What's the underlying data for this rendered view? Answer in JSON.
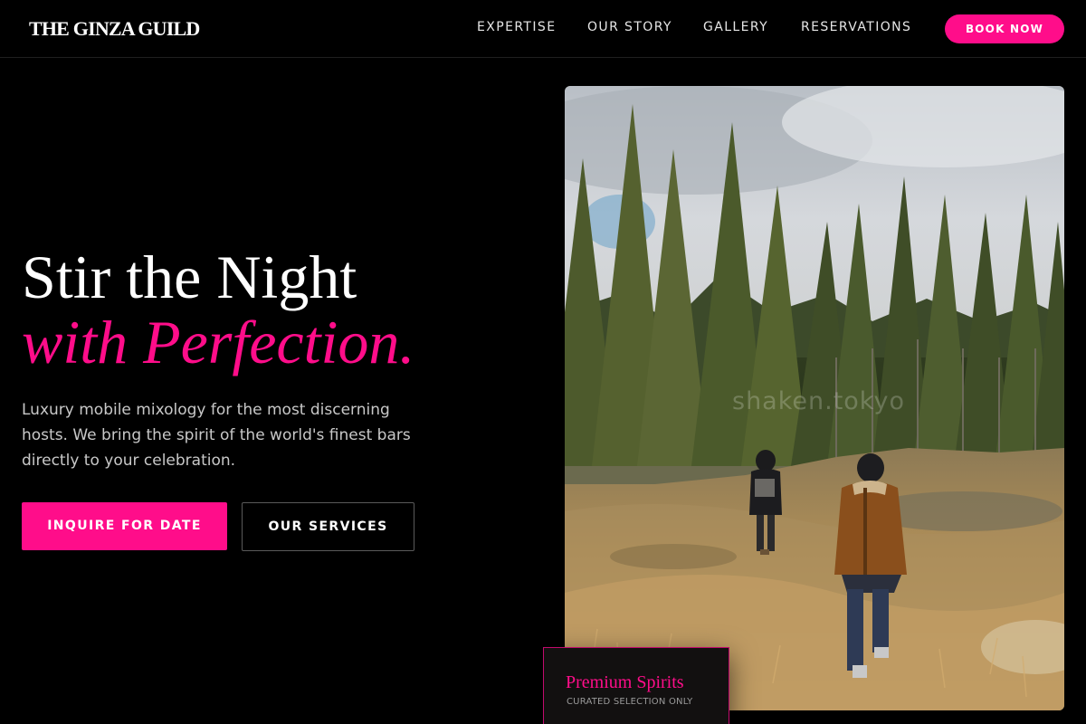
{
  "brand": {
    "name": "THE GINZA GUILD",
    "accent_color": "#ff0d8a"
  },
  "nav": {
    "items": [
      {
        "label": "EXPERTISE"
      },
      {
        "label": "OUR STORY"
      },
      {
        "label": "GALLERY"
      },
      {
        "label": "RESERVATIONS"
      }
    ],
    "cta_label": "BOOK NOW"
  },
  "hero": {
    "title_line1": "Stir the Night",
    "title_line2": "with Perfection.",
    "description": "Luxury mobile mixology for the most discerning hosts. We bring the spirit of the world's finest bars directly to your celebration.",
    "primary_button": "INQUIRE FOR DATE",
    "secondary_button": "OUR SERVICES"
  },
  "image": {
    "subject": "two people walking through a forest clearing with tall pine trees and dry grass",
    "watermark": "shaken.tokyo"
  },
  "feature_card": {
    "title": "Premium Spirits",
    "subtitle": "CURATED SELECTION ONLY"
  }
}
